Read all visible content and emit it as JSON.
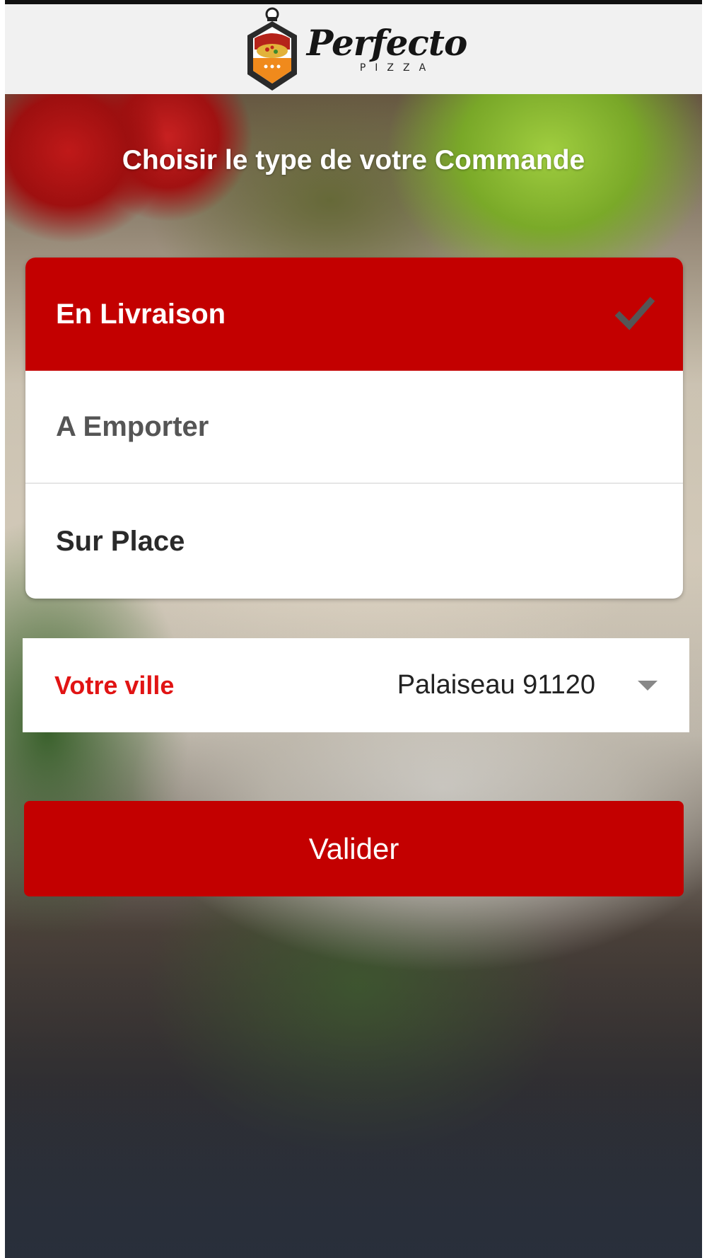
{
  "header": {
    "logo_name": "Perfecto",
    "logo_sub": "PIZZA"
  },
  "heading": "Choisir le type de votre Commande",
  "order_types": [
    {
      "label": "En Livraison",
      "selected": true
    },
    {
      "label": "A Emporter",
      "selected": false
    },
    {
      "label": "Sur Place",
      "selected": false
    }
  ],
  "city": {
    "label": "Votre ville",
    "value": "Palaiseau 91120"
  },
  "submit_label": "Valider",
  "colors": {
    "primary": "#c30000",
    "city_label": "#e11414",
    "header_bg": "#f1f1f1"
  },
  "icons": [
    "logo-icon",
    "check-icon",
    "dropdown-arrow-icon"
  ]
}
